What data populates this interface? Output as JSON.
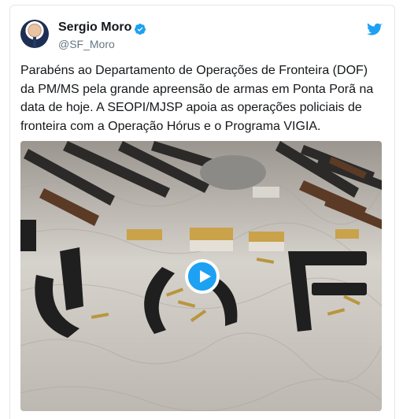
{
  "tweet": {
    "author_name": "Sergio Moro",
    "author_handle": "@SF_Moro",
    "text_lines": [
      "Parabéns ao Departamento de Operações de Fronteira (DOF)",
      "da PM/MS pela grande apreensão de armas em Ponta Porã na",
      "data de hoje. A SEOPI/MJSP apoia as operações policiais de",
      "fronteira com a Operação Hórus e o Programa VIGIA."
    ],
    "verified_icon": "verified-badge-icon",
    "logo_icon": "twitter-bird-icon",
    "media": {
      "type": "video",
      "play_icon": "play-icon"
    }
  },
  "colors": {
    "accent": "#1da1f2",
    "text": "#14171a",
    "secondary": "#657786",
    "border": "#e1e8ed"
  }
}
